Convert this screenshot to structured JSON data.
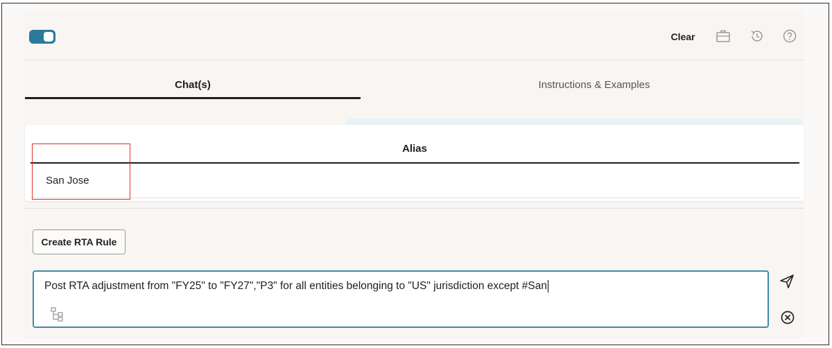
{
  "header": {
    "toggle": {
      "state": "on",
      "accent": "#2b7a9b"
    },
    "clear_label": "Clear",
    "icons": [
      "briefcase-icon",
      "history-icon",
      "help-icon"
    ]
  },
  "tabs": [
    {
      "label": "Chat(s)",
      "active": true
    },
    {
      "label": "Instructions & Examples",
      "active": false
    }
  ],
  "table": {
    "columns": [
      "Alias"
    ],
    "rows": [
      [
        "San Jose"
      ]
    ],
    "highlight_color": "#d9302c"
  },
  "actions": {
    "create_rule_label": "Create RTA Rule"
  },
  "prompt_input": {
    "value": "Post RTA adjustment from \"FY25\" to \"FY27\",\"P3\" for all entities belonging to \"US\" jurisdiction except  #San",
    "border_color": "#3d8aa5"
  },
  "icons": {
    "hierarchy": "hierarchy-icon",
    "send": "send-icon",
    "cancel": "cancel-icon"
  }
}
